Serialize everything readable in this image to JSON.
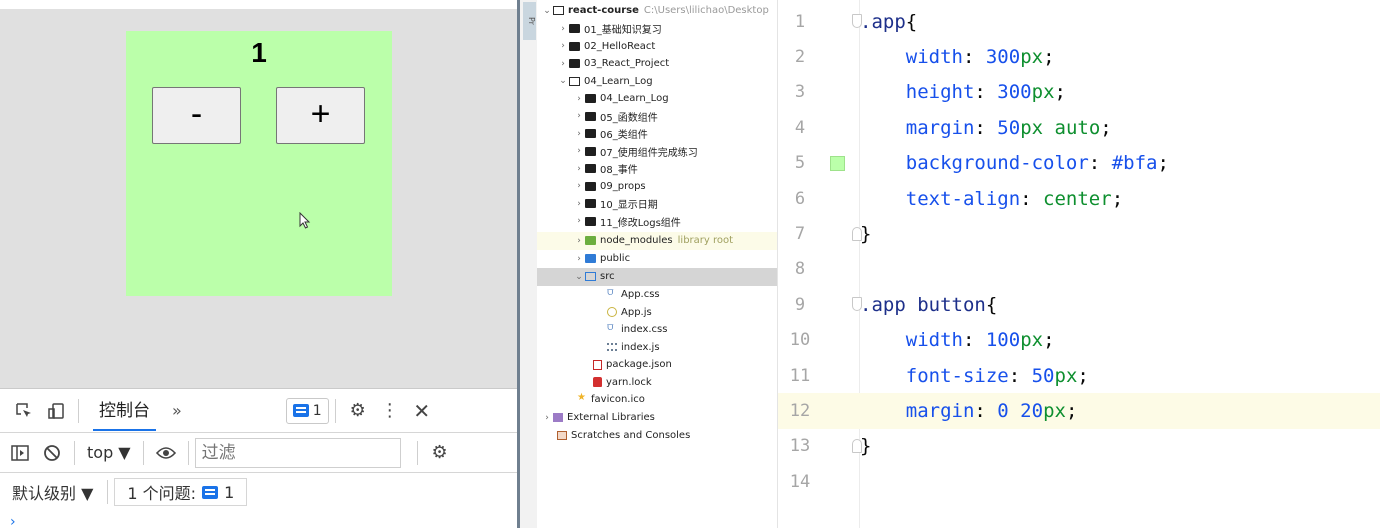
{
  "app_preview": {
    "count": "1",
    "minus_label": "-",
    "plus_label": "+"
  },
  "devtools": {
    "console_tab": "控制台",
    "more_tabs": "»",
    "issues_badge_count": "1",
    "context_select": "top ▼",
    "filter_placeholder": "过滤",
    "level_select": "默认级别 ▼",
    "issues_label": "1 个问题:",
    "issues_count": "1",
    "prompt": "›"
  },
  "project_tree": {
    "panel_tab": "Pr",
    "root_name": "react-course",
    "root_path": "C:\\Users\\lilichao\\Desktop",
    "items": [
      {
        "label": "01_基础知识复习",
        "type": "folder"
      },
      {
        "label": "02_HelloReact",
        "type": "folder"
      },
      {
        "label": "03_React_Project",
        "type": "folder"
      },
      {
        "label": "04_Learn_Log",
        "type": "folder-open"
      },
      {
        "label": "04_Learn_Log",
        "type": "folder"
      },
      {
        "label": "05_函数组件",
        "type": "folder"
      },
      {
        "label": "06_类组件",
        "type": "folder"
      },
      {
        "label": "07_使用组件完成练习",
        "type": "folder"
      },
      {
        "label": "08_事件",
        "type": "folder"
      },
      {
        "label": "09_props",
        "type": "folder"
      },
      {
        "label": "10_显示日期",
        "type": "folder"
      },
      {
        "label": "11_修改Logs组件",
        "type": "folder"
      },
      {
        "label": "node_modules",
        "type": "folder-green",
        "suffix": "library root"
      },
      {
        "label": "public",
        "type": "folder-blue"
      },
      {
        "label": "src",
        "type": "folder-src"
      },
      {
        "label": "App.css",
        "type": "css"
      },
      {
        "label": "App.js",
        "type": "js"
      },
      {
        "label": "index.css",
        "type": "css"
      },
      {
        "label": "index.js",
        "type": "jsidx"
      },
      {
        "label": "package.json",
        "type": "json"
      },
      {
        "label": "yarn.lock",
        "type": "lock"
      },
      {
        "label": "favicon.ico",
        "type": "star"
      },
      {
        "label": "External Libraries",
        "type": "lib"
      },
      {
        "label": "Scratches and Consoles",
        "type": "scratch"
      }
    ]
  },
  "editor": {
    "line_numbers": [
      "1",
      "2",
      "3",
      "4",
      "5",
      "6",
      "7",
      "8",
      "9",
      "10",
      "11",
      "12",
      "13",
      "14"
    ],
    "swatch_color": "#bbffaa",
    "lines": [
      [
        {
          "t": ".app",
          "c": "sel"
        },
        {
          "t": "{",
          "c": "pun"
        }
      ],
      [
        {
          "t": "    ",
          "c": "pun"
        },
        {
          "t": "width",
          "c": "prop"
        },
        {
          "t": ": ",
          "c": "pun"
        },
        {
          "t": "300",
          "c": "prop"
        },
        {
          "t": "px",
          "c": "num"
        },
        {
          "t": ";",
          "c": "pun"
        }
      ],
      [
        {
          "t": "    ",
          "c": "pun"
        },
        {
          "t": "height",
          "c": "prop"
        },
        {
          "t": ": ",
          "c": "pun"
        },
        {
          "t": "300",
          "c": "prop"
        },
        {
          "t": "px",
          "c": "num"
        },
        {
          "t": ";",
          "c": "pun"
        }
      ],
      [
        {
          "t": "    ",
          "c": "pun"
        },
        {
          "t": "margin",
          "c": "prop"
        },
        {
          "t": ": ",
          "c": "pun"
        },
        {
          "t": "50",
          "c": "prop"
        },
        {
          "t": "px ",
          "c": "num"
        },
        {
          "t": "auto",
          "c": "val"
        },
        {
          "t": ";",
          "c": "pun"
        }
      ],
      [
        {
          "t": "    ",
          "c": "pun"
        },
        {
          "t": "background-color",
          "c": "prop"
        },
        {
          "t": ": ",
          "c": "pun"
        },
        {
          "t": "#bfa",
          "c": "prop"
        },
        {
          "t": ";",
          "c": "pun"
        }
      ],
      [
        {
          "t": "    ",
          "c": "pun"
        },
        {
          "t": "text-align",
          "c": "prop"
        },
        {
          "t": ": ",
          "c": "pun"
        },
        {
          "t": "center",
          "c": "val"
        },
        {
          "t": ";",
          "c": "pun"
        }
      ],
      [
        {
          "t": "}",
          "c": "pun"
        }
      ],
      [],
      [
        {
          "t": ".app button",
          "c": "sel"
        },
        {
          "t": "{",
          "c": "pun"
        }
      ],
      [
        {
          "t": "    ",
          "c": "pun"
        },
        {
          "t": "width",
          "c": "prop"
        },
        {
          "t": ": ",
          "c": "pun"
        },
        {
          "t": "100",
          "c": "prop"
        },
        {
          "t": "px",
          "c": "num"
        },
        {
          "t": ";",
          "c": "pun"
        }
      ],
      [
        {
          "t": "    ",
          "c": "pun"
        },
        {
          "t": "font-size",
          "c": "prop"
        },
        {
          "t": ": ",
          "c": "pun"
        },
        {
          "t": "50",
          "c": "prop"
        },
        {
          "t": "px",
          "c": "num"
        },
        {
          "t": ";",
          "c": "pun"
        }
      ],
      [
        {
          "t": "    ",
          "c": "pun"
        },
        {
          "t": "margin",
          "c": "prop"
        },
        {
          "t": ": ",
          "c": "pun"
        },
        {
          "t": "0 20",
          "c": "prop"
        },
        {
          "t": "px",
          "c": "num"
        },
        {
          "t": ";",
          "c": "pun"
        }
      ],
      [
        {
          "t": "}",
          "c": "pun"
        }
      ],
      []
    ],
    "current_line": "12"
  }
}
